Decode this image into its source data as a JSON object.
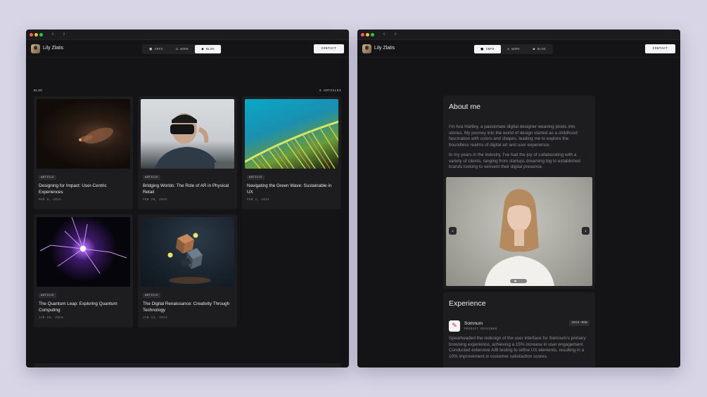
{
  "brand": {
    "name": "Lily Zlatis"
  },
  "nav": {
    "back_icon": "chevron-left-icon",
    "forward_icon": "chevron-right-icon",
    "tabs": [
      {
        "label": "INFO",
        "icon": "info-icon"
      },
      {
        "label": "WORK",
        "icon": "home-icon"
      },
      {
        "label": "BLOG",
        "icon": "blog-icon"
      }
    ],
    "contact_label": "CONTACT"
  },
  "blog_window": {
    "active_tab": "BLOG",
    "section_label": "BLOG",
    "count_label": "5 ARTICLES",
    "articles": [
      {
        "badge": "ARTICLE",
        "title": "Designing for Impact: User-Centric Experiences",
        "date": "MAR 8, 2024",
        "image": "hands-holding-light"
      },
      {
        "badge": "ARTICLE",
        "title": "Bridging Worlds: The Role of AR in Physical Retail",
        "date": "FEB 28, 2024",
        "image": "man-with-vr-headset"
      },
      {
        "badge": "ARTICLE",
        "title": "Navigating the Green Wave: Sustainable in UX",
        "date": "FEB 1, 2024",
        "image": "palm-leaf"
      },
      {
        "badge": "ARTICLE",
        "title": "The Quantum Leap: Exploring Quantum Computing",
        "date": "JAN 28, 2023",
        "image": "plasma-ball"
      },
      {
        "badge": "ARTICLE",
        "title": "The Digital Renaissance: Creativity Through Technology",
        "date": "JAN 13, 2023",
        "image": "floating-cubes"
      }
    ]
  },
  "info_window": {
    "active_tab": "INFO",
    "about": {
      "title": "About me",
      "paragraphs": [
        "I'm Ava Hartley, a passionate digital designer weaving pixels into stories. My journey into the world of design started as a childhood fascination with colors and shapes, leading me to explore the boundless realms of digital art and user experience.",
        "In my years in the industry, I've had the joy of collaborating with a variety of clients, ranging from startups dreaming big to established brands looking to reinvent their digital presence."
      ],
      "carousel": {
        "image": "portrait-woman",
        "prev_icon": "chevron-left-icon",
        "next_icon": "chevron-right-icon",
        "slide_count": 3,
        "active_slide": 1
      }
    },
    "experience": {
      "title": "Experience",
      "items": [
        {
          "company": "Somnum",
          "role": "PRODUCT DESIGNER",
          "years": "2022-NOW",
          "logo_glyph": "✎",
          "description": "Spearheaded the redesign of the user interface for Somnum's primary browsing experience, achieving a 15% increase in user engagement. Conducted extensive A/B testing to refine UX elements, resulting in a 10% improvement in customer satisfaction scores."
        }
      ]
    }
  },
  "colors": {
    "background": "#d8d6e6",
    "window": "#141416",
    "card": "#1d1d20",
    "accent_light": "#f4f4f6"
  }
}
